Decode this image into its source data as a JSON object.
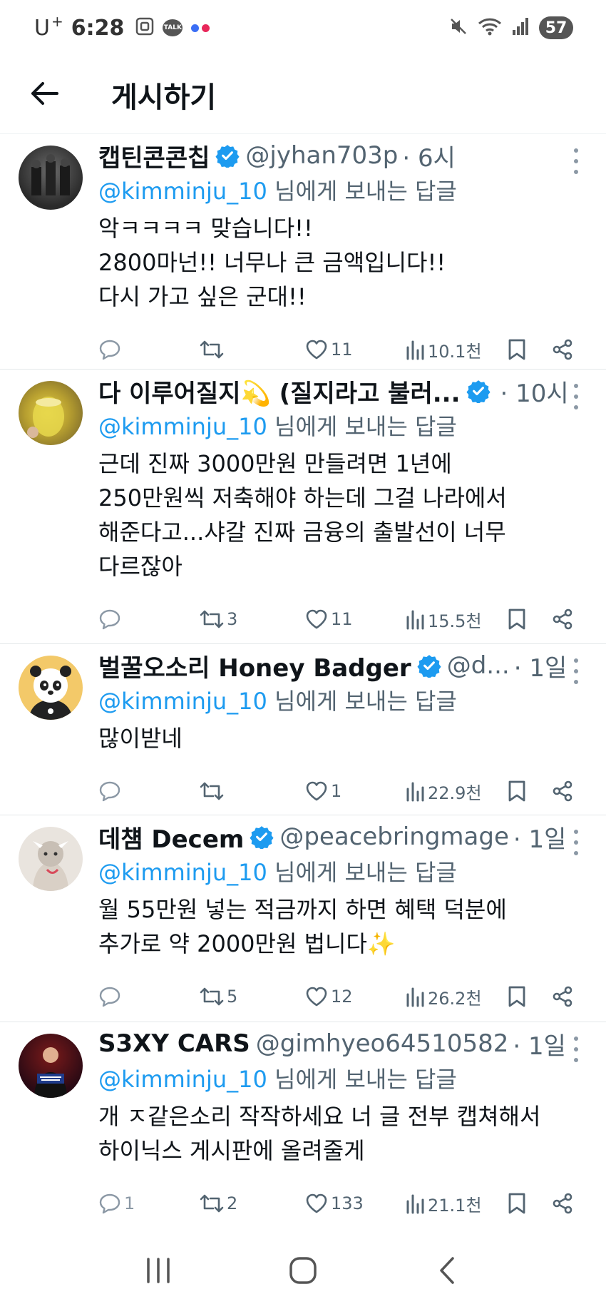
{
  "status_bar": {
    "carrier": "U",
    "carrier_sup": "+",
    "time": "6:28",
    "talk_label": "TALK",
    "battery": "57",
    "icons": [
      "screen-record-icon",
      "kakaotalk-icon",
      "flickr-dots-icon",
      "mute-icon",
      "wifi-icon",
      "signal-icon",
      "battery-icon"
    ]
  },
  "header": {
    "title": "게시하기",
    "back_icon": "arrow-left-icon"
  },
  "reply_label_suffix": " 님에게 보내는 답글",
  "tweets": [
    {
      "author": "캡틴콘콘칩",
      "handle": "@jyhan703p",
      "time": "· 6시",
      "mention": "@kimminju_10",
      "text": "악ㅋㅋㅋㅋ 맞습니다!!\n2800마넌!! 너무나 큰 금액입니다!!\n다시 가고 싶은 군대!!",
      "replies": "",
      "retweets": "",
      "likes": "11",
      "views": "10.1천"
    },
    {
      "author": "다 이루어질지💫 (질지라고 불러...",
      "handle": "",
      "time": "· 10시",
      "mention": "@kimminju_10",
      "text": "근데 진짜 3000만원 만들려면 1년에\n250만원씩 저축해야 하는데 그걸 나라에서\n해준다고...샤갈 진짜 금융의 출발선이 너무\n다르잖아",
      "replies": "",
      "retweets": "3",
      "likes": "11",
      "views": "15.5천"
    },
    {
      "author": "벌꿀오소리 Honey Badger",
      "handle": "@d...",
      "time": "· 1일",
      "mention": "@kimminju_10",
      "text": "많이받네",
      "replies": "",
      "retweets": "",
      "likes": "1",
      "views": "22.9천"
    },
    {
      "author": "데첌 Decem",
      "handle": "@peacebringmage",
      "time": "· 1일",
      "mention": "@kimminju_10",
      "text": "월 55만원 넣는 적금까지 하면 혜택 덕분에\n추가로 약 2000만원 법니다✨",
      "replies": "",
      "retweets": "5",
      "likes": "12",
      "views": "26.2천"
    },
    {
      "author": "S3XY CARS",
      "handle": "@gimhyeo64510582",
      "time": "· 1일",
      "mention": "@kimminju_10",
      "text": "개 ㅈ같은소리 작작하세요 너 글 전부 캡쳐해서\n하이닉스 게시판에 올려줄게",
      "replies": "1",
      "retweets": "2",
      "likes": "133",
      "views": "21.1천"
    }
  ],
  "nav": {
    "icons": [
      "recent-apps-icon",
      "home-icon",
      "back-icon"
    ]
  },
  "colors": {
    "accent": "#1d9bf0",
    "muted": "#536471",
    "text": "#0f1419"
  }
}
